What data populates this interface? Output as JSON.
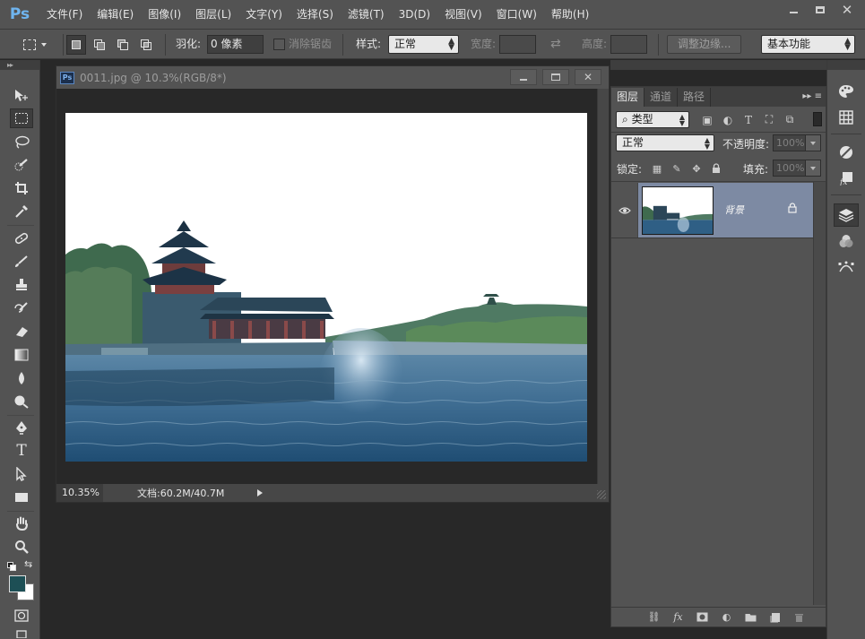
{
  "app": {
    "logo": "Ps"
  },
  "menu": [
    "文件(F)",
    "编辑(E)",
    "图像(I)",
    "图层(L)",
    "文字(Y)",
    "选择(S)",
    "滤镜(T)",
    "3D(D)",
    "视图(V)",
    "窗口(W)",
    "帮助(H)"
  ],
  "options": {
    "feather_label": "羽化:",
    "feather_value": "0 像素",
    "antialias_label": "消除锯齿",
    "style_label": "样式:",
    "style_value": "正常",
    "width_label": "宽度:",
    "height_label": "高度:",
    "refine_edge_label": "调整边缘...",
    "workspace_value": "基本功能"
  },
  "document": {
    "title": "0011.jpg @ 10.3%(RGB/8*)",
    "zoom": "10.35%",
    "doc_info": "文档:60.2M/40.7M"
  },
  "layers_panel": {
    "tabs": [
      "图层",
      "通道",
      "路径"
    ],
    "filter_kind": "类型",
    "blend_mode": "正常",
    "opacity_label": "不透明度:",
    "opacity_value": "100%",
    "lock_label": "锁定:",
    "fill_label": "填充:",
    "fill_value": "100%",
    "layers": [
      {
        "name": "背景",
        "visible": true,
        "locked": true
      }
    ]
  },
  "colors": {
    "foreground": "#1d4f55",
    "background": "#ffffff",
    "selected_layer": "#7d8aa3"
  }
}
